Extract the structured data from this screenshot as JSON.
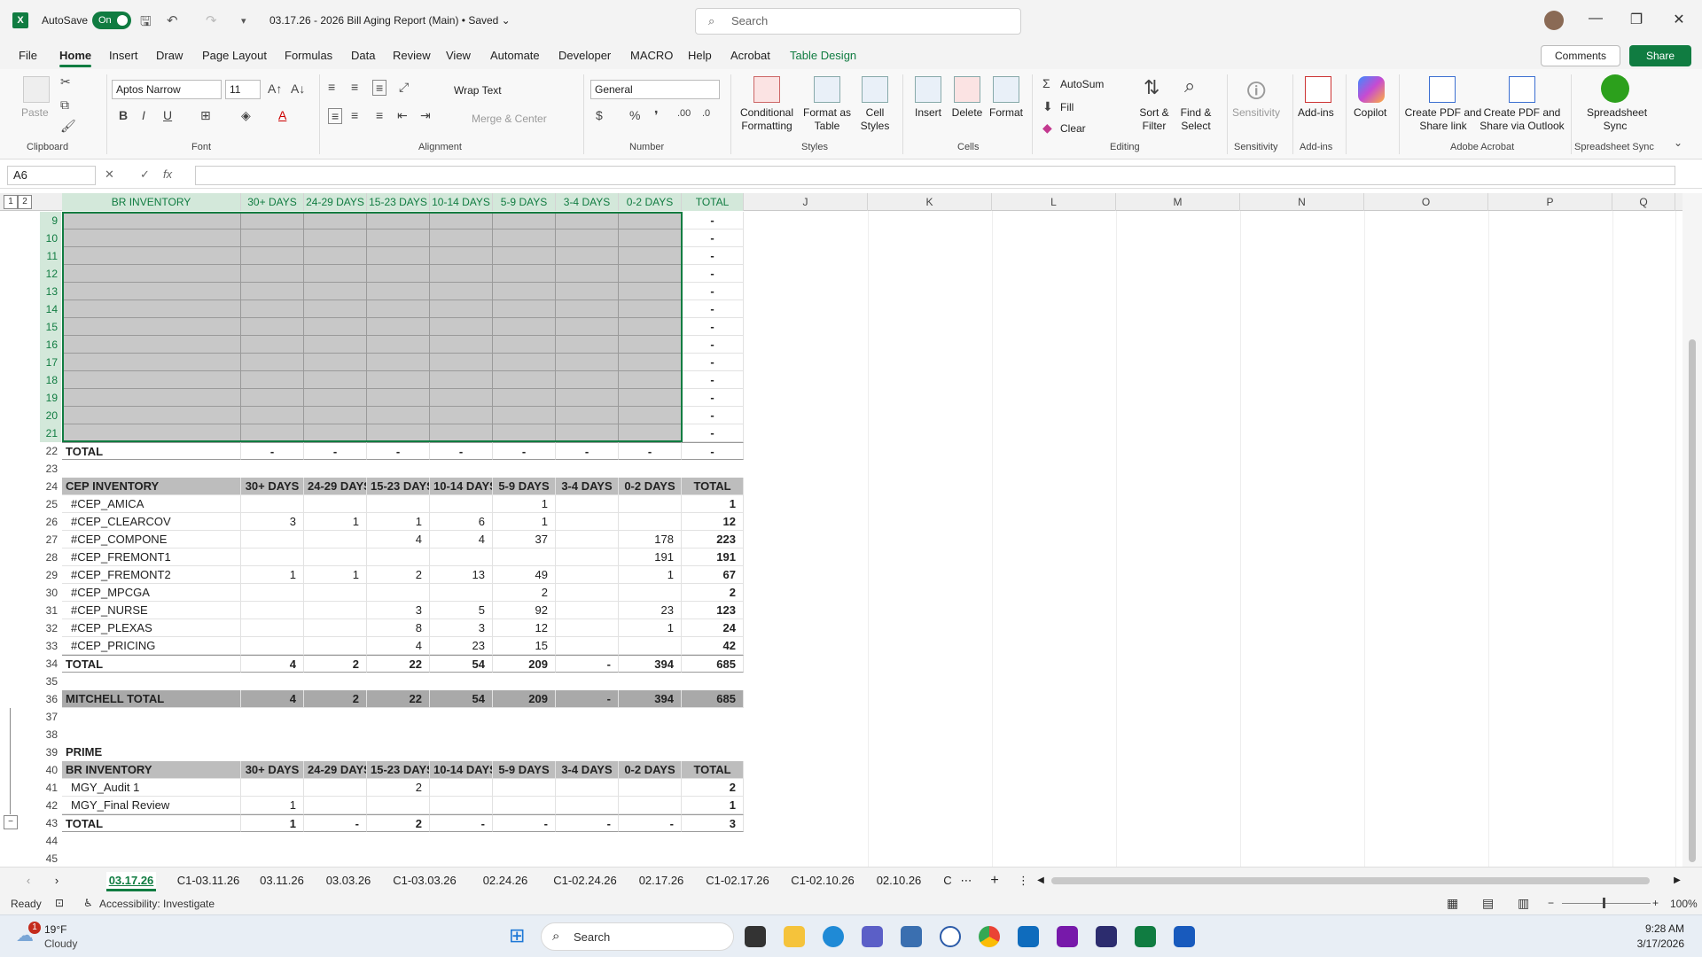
{
  "titlebar": {
    "autosave_label": "AutoSave",
    "autosave_state": "On",
    "doc_title": "03.17.26 - 2026 Bill Aging Report (Main) • Saved ⌄",
    "search_placeholder": "Search"
  },
  "menu": {
    "tabs": [
      "File",
      "Home",
      "Insert",
      "Draw",
      "Page Layout",
      "Formulas",
      "Data",
      "Review",
      "View",
      "Automate",
      "Developer",
      "MACRO",
      "Help",
      "Acrobat",
      "Table Design"
    ],
    "active": "Home",
    "comments": "Comments",
    "share": "Share"
  },
  "ribbon": {
    "paste": "Paste",
    "font_name": "Aptos Narrow",
    "font_size": "11",
    "wrap_text": "Wrap Text",
    "merge_center": "Merge & Center",
    "number_format": "General",
    "conditional_formatting": "Conditional Formatting",
    "format_as_table": "Format as Table",
    "cell_styles": "Cell Styles",
    "insert": "Insert",
    "delete": "Delete",
    "format": "Format",
    "autosum": "AutoSum",
    "fill": "Fill",
    "clear": "Clear",
    "sort_filter": "Sort & Filter",
    "find_select": "Find & Select",
    "sensitivity": "Sensitivity",
    "addins": "Add-ins",
    "copilot": "Copilot",
    "create_pdf_link": "Create PDF and Share link",
    "create_pdf_outlook": "Create PDF and Share via Outlook",
    "spreadsheet_sync": "Spreadsheet Sync",
    "groups": {
      "clipboard": "Clipboard",
      "font": "Font",
      "alignment": "Alignment",
      "number": "Number",
      "styles": "Styles",
      "cells": "Cells",
      "editing": "Editing",
      "sensitivity": "Sensitivity",
      "addins": "Add-ins",
      "adobe": "Adobe Acrobat",
      "sync": "Spreadsheet Sync"
    }
  },
  "formula_bar": {
    "name_box": "A6",
    "fx": "fx"
  },
  "grid": {
    "outline_levels": [
      "1",
      "2"
    ],
    "columns": [
      "BR INVENTORY",
      "30+ DAYS",
      "24-29 DAYS",
      "15-23 DAYS",
      "10-14 DAYS",
      "5-9 DAYS",
      "3-4 DAYS",
      "0-2 DAYS",
      "TOTAL",
      "J",
      "K",
      "L",
      "M",
      "N",
      "O",
      "P",
      "Q"
    ],
    "br_section": {
      "rows": [
        "9",
        "10",
        "11",
        "12",
        "13",
        "14",
        "15",
        "16",
        "17",
        "18",
        "19",
        "20",
        "21"
      ],
      "dash": "-",
      "total_row": "22",
      "total_label": "TOTAL",
      "total_values": [
        "-",
        "-",
        "-",
        "-",
        "-",
        "-",
        "-",
        "-"
      ]
    },
    "cep_section": {
      "header_row": "24",
      "header": [
        "CEP INVENTORY",
        "30+ DAYS",
        "24-29 DAYS",
        "15-23 DAYS",
        "10-14 DAYS",
        "5-9 DAYS",
        "3-4 DAYS",
        "0-2 DAYS",
        "TOTAL"
      ],
      "rows": [
        {
          "n": "25",
          "v": [
            "#CEP_AMICA",
            "",
            "",
            "",
            "",
            "1",
            "",
            "",
            "1"
          ]
        },
        {
          "n": "26",
          "v": [
            "#CEP_CLEARCOV",
            "3",
            "1",
            "1",
            "6",
            "1",
            "",
            "",
            "12"
          ]
        },
        {
          "n": "27",
          "v": [
            "#CEP_COMPONE",
            "",
            "",
            "4",
            "4",
            "37",
            "",
            "178",
            "223"
          ]
        },
        {
          "n": "28",
          "v": [
            "#CEP_FREMONT1",
            "",
            "",
            "",
            "",
            "",
            "",
            "191",
            "191"
          ]
        },
        {
          "n": "29",
          "v": [
            "#CEP_FREMONT2",
            "1",
            "1",
            "2",
            "13",
            "49",
            "",
            "1",
            "67"
          ]
        },
        {
          "n": "30",
          "v": [
            "#CEP_MPCGA",
            "",
            "",
            "",
            "",
            "2",
            "",
            "",
            "2"
          ]
        },
        {
          "n": "31",
          "v": [
            "#CEP_NURSE",
            "",
            "",
            "3",
            "5",
            "92",
            "",
            "23",
            "123"
          ]
        },
        {
          "n": "32",
          "v": [
            "#CEP_PLEXAS",
            "",
            "",
            "8",
            "3",
            "12",
            "",
            "1",
            "24"
          ]
        },
        {
          "n": "33",
          "v": [
            "#CEP_PRICING",
            "",
            "",
            "4",
            "23",
            "15",
            "",
            "",
            "42"
          ]
        }
      ],
      "total": {
        "n": "34",
        "v": [
          "TOTAL",
          "4",
          "2",
          "22",
          "54",
          "209",
          "-",
          "394",
          "685"
        ]
      }
    },
    "mitchell": {
      "n": "36",
      "v": [
        "MITCHELL TOTAL",
        "4",
        "2",
        "22",
        "54",
        "209",
        "-",
        "394",
        "685"
      ]
    },
    "prime": {
      "label_row": "39",
      "label": "PRIME",
      "header_row": "40",
      "header": [
        "BR INVENTORY",
        "30+ DAYS",
        "24-29 DAYS",
        "15-23 DAYS",
        "10-14 DAYS",
        "5-9 DAYS",
        "3-4 DAYS",
        "0-2 DAYS",
        "TOTAL"
      ],
      "rows": [
        {
          "n": "41",
          "v": [
            "MGY_Audit 1",
            "",
            "",
            "2",
            "",
            "",
            "",
            "",
            "2"
          ]
        },
        {
          "n": "42",
          "v": [
            "MGY_Final Review",
            "1",
            "",
            "",
            "",
            "",
            "",
            "",
            "1"
          ]
        }
      ],
      "total": {
        "n": "43",
        "v": [
          "TOTAL",
          "1",
          "-",
          "2",
          "-",
          "-",
          "-",
          "-",
          "3"
        ]
      }
    },
    "blank_rows": [
      "23",
      "35",
      "37",
      "38",
      "44",
      "45"
    ]
  },
  "sheets": {
    "tabs": [
      "03.17.26",
      "C1-03.11.26",
      "03.11.26",
      "03.03.26",
      "C1-03.03.26",
      "02.24.26",
      "C1-02.24.26",
      "02.17.26",
      "C1-02.17.26",
      "C1-02.10.26",
      "02.10.26",
      "C"
    ],
    "active": "03.17.26"
  },
  "status": {
    "ready": "Ready",
    "accessibility": "Accessibility: Investigate",
    "zoom": "100%"
  },
  "taskbar": {
    "weather_temp": "19°F",
    "weather_desc": "Cloudy",
    "weather_badge": "1",
    "search": "Search",
    "time": "9:28 AM",
    "date": "3/17/2026"
  }
}
